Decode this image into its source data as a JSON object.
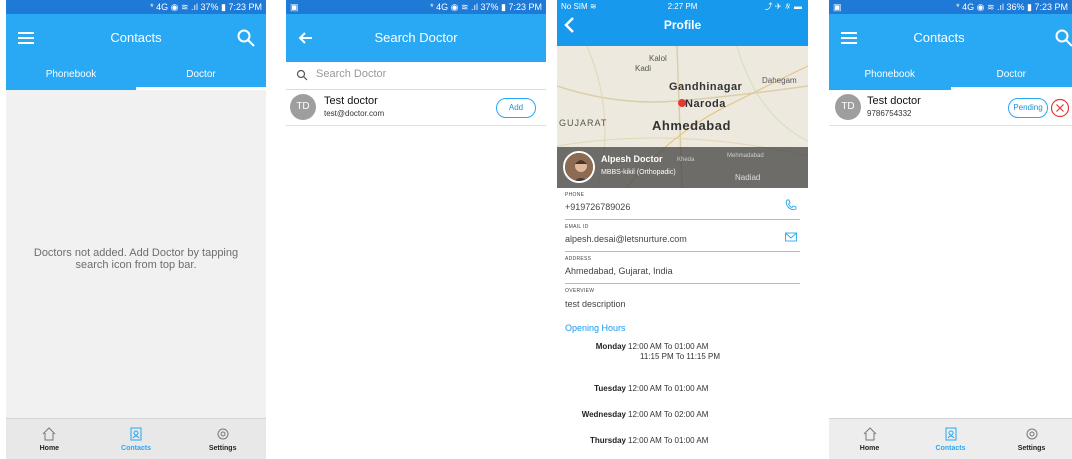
{
  "screen1": {
    "status": "* 4G ◉ ≋ .ıl 37% ▮ 7:23 PM",
    "title": "Contacts",
    "tabs": [
      "Phonebook",
      "Doctor"
    ],
    "active_tab": 1,
    "empty_message": "Doctors not added. Add Doctor by tapping search icon from top bar.",
    "nav": [
      "Home",
      "Contacts",
      "Settings"
    ]
  },
  "screen2": {
    "status": "* 4G ◉ ≋ .ıl 37% ▮ 7:23 PM",
    "title": "Search Doctor",
    "search_placeholder": "Search Doctor",
    "result": {
      "initials": "TD",
      "name": "Test doctor",
      "email": "test@doctor.com",
      "action": "Add"
    }
  },
  "screen3": {
    "status_left": "No SIM ≋",
    "status_time": "2:27 PM",
    "status_right": "⤴ ✈ ∦ ▬",
    "title": "Profile",
    "map_labels": [
      "Kadi",
      "Gandhinagar",
      "Naroda",
      "GUJARAT",
      "Ahmedabad",
      "Kalol",
      "Dahegam",
      "Nadiad",
      "Kheda",
      "Mehmadabad"
    ],
    "doctor_name": "Alpesh Doctor",
    "doctor_degree": "MBBS-kikil (Orthopadic)",
    "fields": [
      {
        "label": "PHONE",
        "value": "+919726789026",
        "icon": "phone-icon"
      },
      {
        "label": "EMAIL ID",
        "value": "alpesh.desai@letsnurture.com",
        "icon": "mail-icon"
      },
      {
        "label": "ADDRESS",
        "value": "Ahmedabad, Gujarat, India"
      }
    ],
    "overview_label": "OVERVIEW",
    "overview_value": "test description",
    "hours_title": "Opening Hours",
    "hours": [
      {
        "day": "Monday",
        "times": [
          "12:00 AM To 01:00 AM",
          "11:15 PM To 11:15 PM"
        ]
      },
      {
        "day": "Tuesday",
        "times": [
          "12:00 AM To 01:00 AM"
        ]
      },
      {
        "day": "Wednesday",
        "times": [
          "12:00 AM To 02:00 AM"
        ]
      },
      {
        "day": "Thursday",
        "times": [
          "12:00 AM To 01:00 AM"
        ]
      }
    ]
  },
  "screen4": {
    "status": "* 4G ◉ ≋ .ıl 36% ▮ 7:23 PM",
    "title": "Contacts",
    "tabs": [
      "Phonebook",
      "Doctor"
    ],
    "active_tab": 1,
    "contact": {
      "initials": "TD",
      "name": "Test doctor",
      "phone": "9786754332",
      "status": "Pending"
    },
    "nav": [
      "Home",
      "Contacts",
      "Settings"
    ],
    "accent_color": "#29a8f3",
    "reject_color": "#e53935"
  }
}
